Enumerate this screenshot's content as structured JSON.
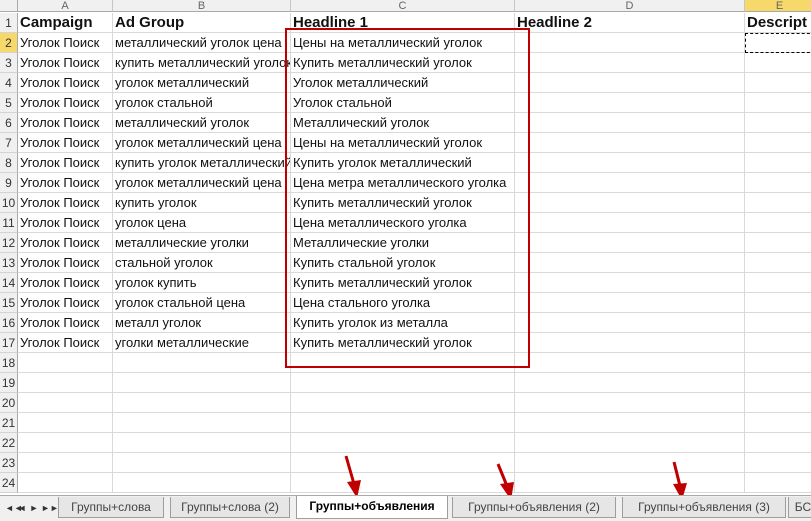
{
  "columns": [
    "A",
    "B",
    "C",
    "D",
    "E"
  ],
  "row_numbers": [
    "1",
    "2",
    "3",
    "4",
    "5",
    "6",
    "7",
    "8",
    "9",
    "10",
    "11",
    "12",
    "13",
    "14",
    "15",
    "16",
    "17",
    "18",
    "19",
    "20",
    "21",
    "22",
    "23",
    "24"
  ],
  "headers": {
    "campaign": "Campaign",
    "ad_group": "Ad Group",
    "headline1": "Headline 1",
    "headline2": "Headline 2",
    "description": "Descript"
  },
  "rows": [
    {
      "campaign": "Уголок Поиск",
      "ad_group": "металлический уголок цена",
      "headline1": "Цены на металлический уголок"
    },
    {
      "campaign": "Уголок Поиск",
      "ad_group": "купить металлический уголок",
      "headline1": "Купить металлический уголок"
    },
    {
      "campaign": "Уголок Поиск",
      "ad_group": "уголок металлический",
      "headline1": "Уголок металлический"
    },
    {
      "campaign": "Уголок Поиск",
      "ad_group": "уголок стальной",
      "headline1": "Уголок стальной"
    },
    {
      "campaign": "Уголок Поиск",
      "ad_group": "металлический уголок",
      "headline1": "Металлический уголок"
    },
    {
      "campaign": "Уголок Поиск",
      "ad_group": "уголок металлический цена",
      "headline1": "Цены на металлический уголок"
    },
    {
      "campaign": "Уголок Поиск",
      "ad_group": "купить уголок металлический",
      "headline1": "Купить уголок металлический"
    },
    {
      "campaign": "Уголок Поиск",
      "ad_group": "уголок металлический цена",
      "headline1": "Цена метра металлического уголка"
    },
    {
      "campaign": "Уголок Поиск",
      "ad_group": "купить уголок",
      "headline1": "Купить металлический уголок"
    },
    {
      "campaign": "Уголок Поиск",
      "ad_group": "уголок цена",
      "headline1": "Цена металлического уголка"
    },
    {
      "campaign": "Уголок Поиск",
      "ad_group": "металлические уголки",
      "headline1": "Металлические уголки"
    },
    {
      "campaign": "Уголок Поиск",
      "ad_group": "стальной уголок",
      "headline1": "Купить стальной уголок"
    },
    {
      "campaign": "Уголок Поиск",
      "ad_group": "уголок купить",
      "headline1": "Купить металлический уголок"
    },
    {
      "campaign": "Уголок Поиск",
      "ad_group": "уголок стальной цена",
      "headline1": "Цена стального уголка"
    },
    {
      "campaign": "Уголок Поиск",
      "ad_group": "металл уголок",
      "headline1": "Купить уголок из металла"
    },
    {
      "campaign": "Уголок Поиск",
      "ad_group": "уголки металлические",
      "headline1": "Купить металлический уголок"
    }
  ],
  "sheet_tabs": [
    {
      "label": "Группы+слова",
      "active": false
    },
    {
      "label": "Группы+слова (2)",
      "active": false
    },
    {
      "label": "Группы+объявления",
      "active": true
    },
    {
      "label": "Группы+объявления (2)",
      "active": false
    },
    {
      "label": "Группы+объявления (3)",
      "active": false
    },
    {
      "label": "БС",
      "active": false
    }
  ],
  "nav_buttons": [
    "◄◄",
    "◄",
    "►",
    "►►"
  ],
  "colors": {
    "highlight_box": "#c00000",
    "active_header": "#f7d96b"
  }
}
